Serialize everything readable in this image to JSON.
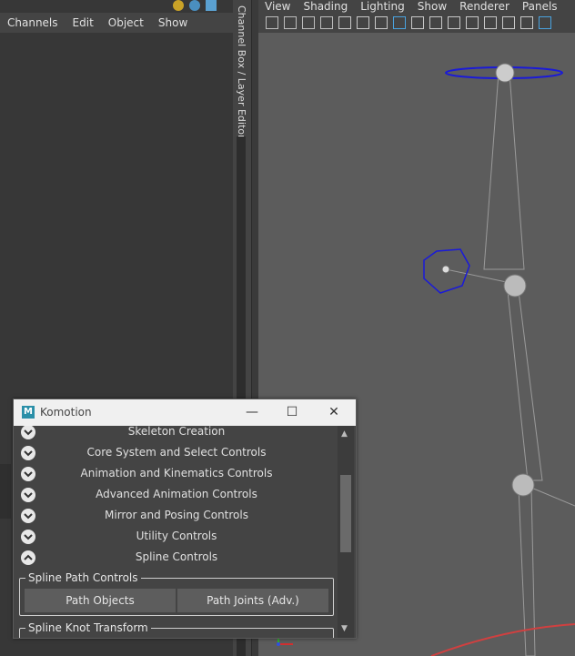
{
  "channel_box": {
    "menu": [
      "Channels",
      "Edit",
      "Object",
      "Show"
    ],
    "tab_label": "Channel Box / Layer Editor"
  },
  "viewport": {
    "menu": [
      "View",
      "Shading",
      "Lighting",
      "Show",
      "Renderer",
      "Panels"
    ],
    "toolbar_icons": [
      "camera-icon",
      "camera-attributes-icon",
      "image-plane-icon",
      "bookmark-icon",
      "snap-icon",
      "isolate-icon",
      "film-gate-icon",
      "grid-icon",
      "resolution-gate-icon",
      "safe-action-icon",
      "field-chart-icon",
      "xray-icon",
      "texture-icon",
      "hud-icon",
      "wireframe-icon",
      "smooth-shade-icon"
    ]
  },
  "komotion": {
    "title": "Komotion",
    "logo": "M",
    "sections": [
      {
        "label": "Skeleton Creation",
        "state": "collapsed"
      },
      {
        "label": "Core System and Select Controls",
        "state": "collapsed"
      },
      {
        "label": "Animation and Kinematics Controls",
        "state": "collapsed"
      },
      {
        "label": "Advanced Animation Controls",
        "state": "collapsed"
      },
      {
        "label": "Mirror and Posing Controls",
        "state": "collapsed"
      },
      {
        "label": "Utility Controls",
        "state": "collapsed"
      },
      {
        "label": "Spline Controls",
        "state": "expanded"
      }
    ],
    "spline_path_group": "Spline Path Controls",
    "path_objects_label": "Path Objects",
    "path_joints_label": "Path Joints (Adv.)",
    "spline_knot_group": "Spline Knot Transform"
  },
  "colors": {
    "accent": "#4aa3df",
    "control_curve": "#1a1ad8",
    "viewport_bg": "#5c5c5c"
  }
}
